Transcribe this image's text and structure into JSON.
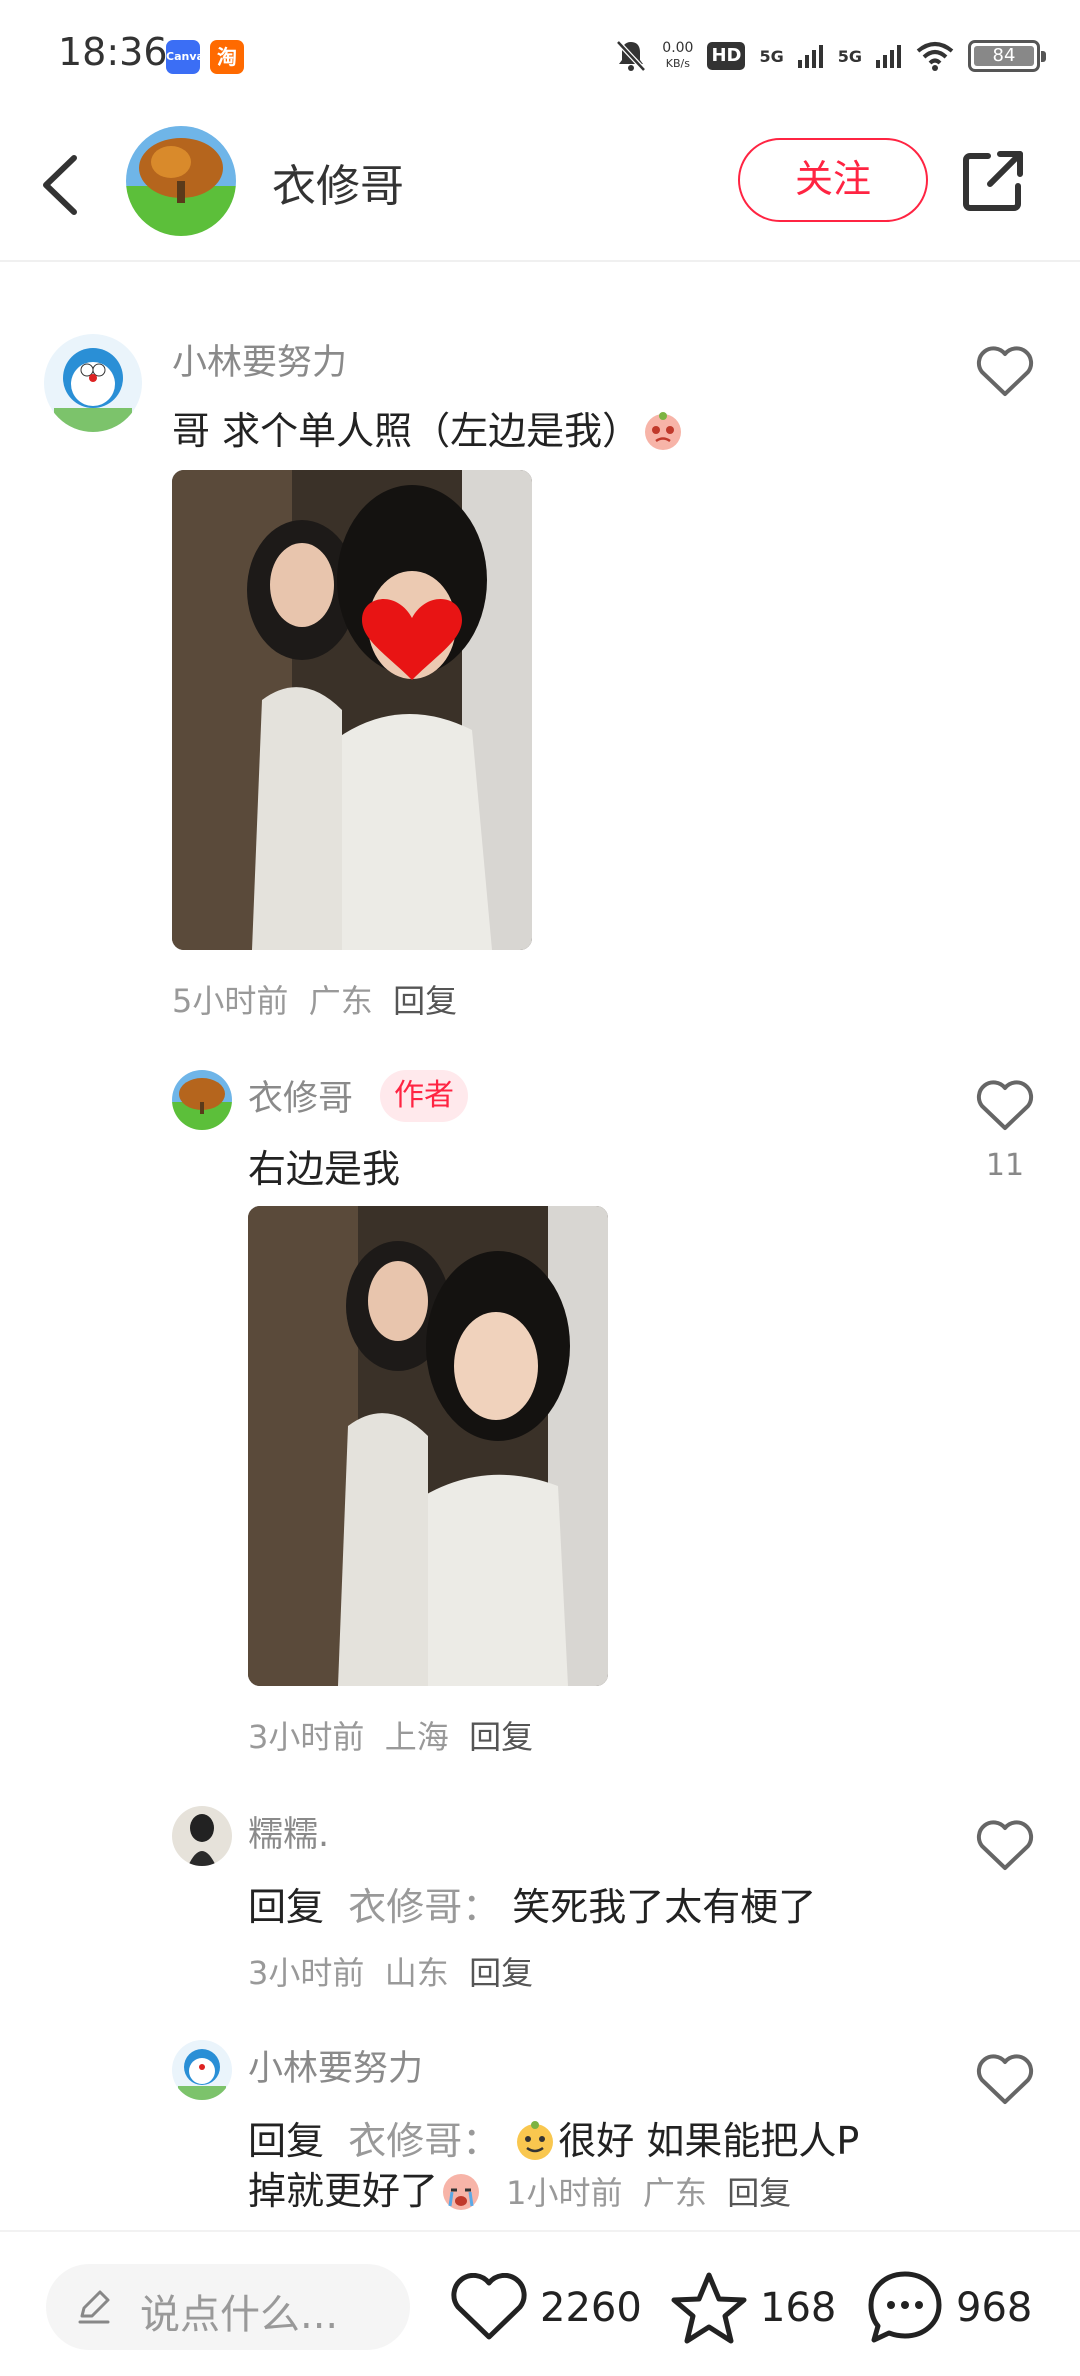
{
  "status_bar": {
    "time": "18:36",
    "app_icons": [
      "Canva",
      "淘"
    ],
    "net_speed": "0.00",
    "net_unit": "KB/s",
    "hd_label": "HD",
    "signal1": "5G",
    "signal2": "5G",
    "battery": "84"
  },
  "header": {
    "username": "衣修哥",
    "follow_label": "关注"
  },
  "comments": [
    {
      "user": "小林要努力",
      "text": "哥  求个单人照（左边是我）",
      "time": "5小时前",
      "location": "广东",
      "reply_label": "回复"
    }
  ],
  "replies": [
    {
      "user": "衣修哥",
      "author_tag": "作者",
      "text": "右边是我",
      "like_count": "11",
      "time": "3小时前",
      "location": "上海",
      "reply_label": "回复"
    },
    {
      "user": "糯糯.",
      "reply_prefix": "回复",
      "reply_to": "衣修哥：",
      "text": "笑死我了太有梗了",
      "time": "3小时前",
      "location": "山东",
      "reply_label": "回复"
    },
    {
      "user": "小林要努力",
      "reply_prefix": "回复",
      "reply_to": "衣修哥：",
      "text_a": "很好  如果能把人P",
      "text_b": "掉就更好了",
      "time": "1小时前",
      "location": "广东",
      "reply_label": "回复"
    }
  ],
  "bottom_bar": {
    "placeholder": "说点什么...",
    "likes": "2260",
    "stars": "168",
    "comments": "968"
  },
  "colors": {
    "accent": "#ff2442",
    "secondary_text": "#8a8a8a",
    "meta_text": "#999999"
  },
  "icons": [
    "back-icon",
    "share-icon",
    "heart-icon",
    "star-icon",
    "comment-icon",
    "pen-icon",
    "mute-bell-icon",
    "wifi-icon"
  ]
}
